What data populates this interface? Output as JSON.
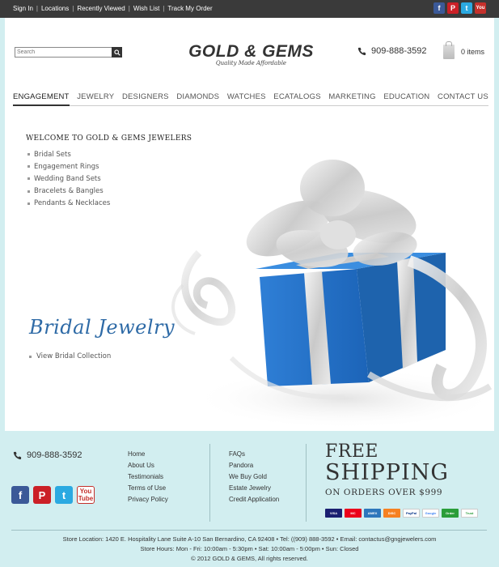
{
  "topbar": {
    "links": [
      "Sign In",
      "Locations",
      "Recently Viewed",
      "Wish List",
      "Track My Order"
    ],
    "separator": "|"
  },
  "header": {
    "search_placeholder": "Search",
    "logo_main": "GOLD & GEMS",
    "logo_tagline": "Quality Made Affordable",
    "phone": "909-888-3592",
    "cart_label": "0 items"
  },
  "nav": [
    "ENGAGEMENT",
    "JEWELRY",
    "DESIGNERS",
    "DIAMONDS",
    "WATCHES",
    "ECATALOGS",
    "MARKETING",
    "EDUCATION",
    "CONTACT US"
  ],
  "hero": {
    "welcome": "WELCOME TO GOLD & GEMS JEWELERS",
    "menu": [
      "Bridal Sets",
      "Engagement Rings",
      "Wedding Band Sets",
      "Bracelets & Bangles",
      "Pendants & Necklaces"
    ],
    "script_title": "Bridal Jewelry",
    "link": "View Bridal Collection"
  },
  "social": {
    "facebook": "f",
    "pinterest": "P",
    "twitter": "t",
    "youtube_1": "You",
    "youtube_2": "Tube"
  },
  "footer": {
    "phone": "909-888-3592",
    "col1": [
      "Home",
      "About Us",
      "Testimonials",
      "Terms of Use",
      "Privacy Policy"
    ],
    "col2": [
      "FAQs",
      "Pandora",
      "We Buy Gold",
      "Estate Jewelry",
      "Credit Application"
    ],
    "free_1": "FREE",
    "free_2": "SHIPPING",
    "free_3": "ON ORDERS OVER $999",
    "cards": [
      "VISA",
      "MC",
      "AMEX",
      "DISC",
      "PayPal",
      "Google",
      "Order",
      "Trust"
    ],
    "location": "Store Location: 1420 E. Hospitality Lane Suite A-10 San Bernardino, CA 92408 • Tel: ((909) 888-3592 • Email: contactus@gngjewelers.com",
    "hours": "Store Hours: Mon - Fri: 10:00am - 5:30pm • Sat: 10:00am - 5:00pm • Sun: Closed",
    "copyright": "© 2012 GOLD & GEMS, All rights reserved."
  },
  "colors": {
    "topbar": "#3a3a3a",
    "footer_bg": "#d2eef0",
    "gift_blue": "#2f7fd6",
    "script_blue": "#2e6aa6"
  }
}
